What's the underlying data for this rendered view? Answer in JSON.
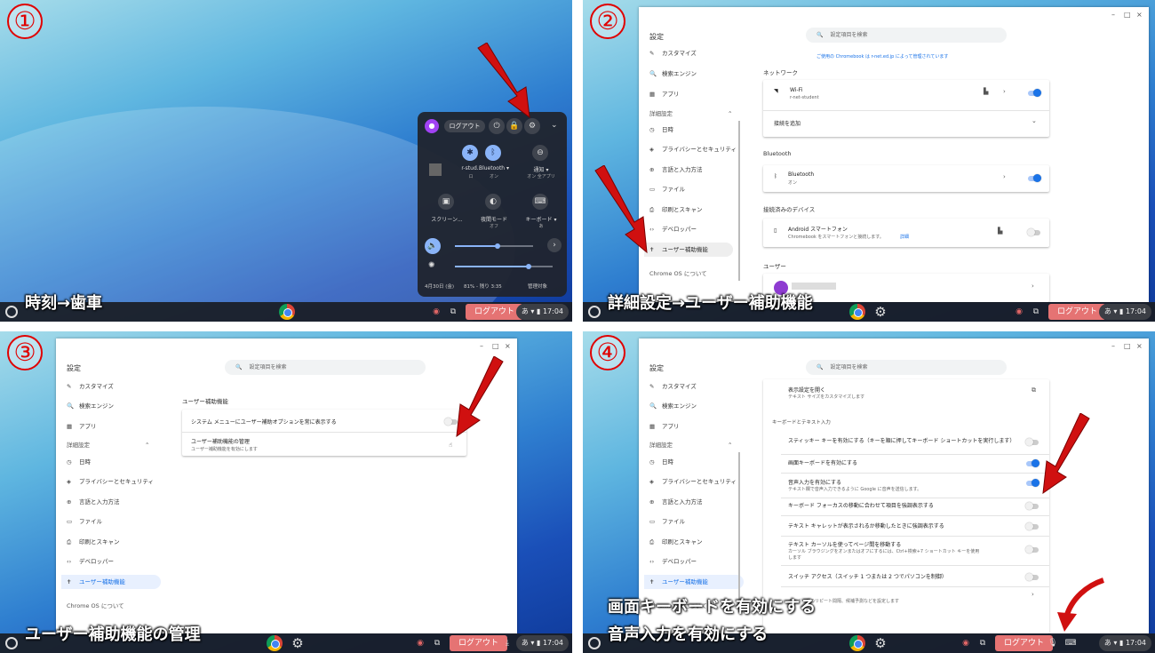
{
  "panels": {
    "p1": {
      "num": "①",
      "caption": "時刻→歯車"
    },
    "p2": {
      "num": "②",
      "caption": "詳細設定→ユーザー補助機能"
    },
    "p3": {
      "num": "③",
      "caption": "ユーザー補助機能の管理"
    },
    "p4": {
      "num": "④",
      "caption1": "画面キーボードを有効にする",
      "caption2": "音声入力を有効にする"
    }
  },
  "shelf": {
    "logout": "ログアウト",
    "time": "17:04",
    "ime": "あ"
  },
  "quick_settings": {
    "logout": "ログアウト",
    "wifi_label": "r-stud..",
    "wifi_sub": "ロ",
    "bt_label": "Bluetooth ▾",
    "bt_sub": "オン",
    "notif_label": "通知 ▾",
    "notif_sub": "オン 全アプリ",
    "screen_label": "スクリーン...",
    "night_label": "夜間モード",
    "night_sub": "オフ",
    "kb_label": "キーボード ▾",
    "kb_sub": "あ",
    "volume_level": 0.55,
    "brightness_level": 0.75,
    "date": "4月30日 (金)",
    "battery": "81% - 残り 3:35",
    "managed": "管理対象"
  },
  "settings": {
    "title": "設定",
    "search_placeholder": "設定項目を検索",
    "managed_notice": "ご使用の Chromebook は      r-net.ed.jp によって管理されています",
    "nav": {
      "customize": "カスタマイズ",
      "search_engine": "検索エンジン",
      "apps": "アプリ",
      "advanced": "詳細設定",
      "datetime": "日時",
      "privacy": "プライバシーとセキュリティ",
      "language": "言語と入力方法",
      "files": "ファイル",
      "print": "印刷とスキャン",
      "developer": "デベロッパー",
      "accessibility": "ユーザー補助機能",
      "about": "Chrome OS について"
    },
    "network": {
      "heading": "ネットワーク",
      "wifi": "Wi-Fi",
      "wifi_ssid": "r-net-student",
      "add": "接続を追加"
    },
    "bluetooth": {
      "heading": "Bluetooth",
      "label": "Bluetooth",
      "sub": "オン"
    },
    "devices": {
      "heading": "接続済みのデバイス",
      "android": "Android スマートフォン",
      "android_sub": "Chromebook をスマートフォンと接続します。",
      "detail": "詳細"
    },
    "user": {
      "heading": "ユーザー"
    },
    "a11y": {
      "heading": "ユーザー補助機能",
      "always_show": "システム メニューにユーザー補助オプションを常に表示する",
      "manage": "ユーザー補助機能の管理",
      "manage_sub": "ユーザー補助機能を有効にします"
    },
    "a11y_detail": {
      "display_open": "表示設定を開く",
      "display_sub": "テキスト サイズをカスタマイズします",
      "kb_heading": "キーボードとテキスト入力",
      "sticky": "スティッキー キーを有効にする（キーを順に押してキーボード ショートカットを実行します）",
      "onscreen": "画面キーボードを有効にする",
      "dictation": "音声入力を有効にする",
      "dictation_sub": "テキスト欄で音声入力できるように Google に音声を送信します。",
      "focus_highlight": "キーボード フォーカスの移動に合わせて項目を強調表示する",
      "caret_highlight": "テキスト キャレットが表示されるか移動したときに強調表示する",
      "caret_browse": "テキスト カーソルを使ってページ間を移動する",
      "caret_browse_sub1": "カーソル ブラウジングをオンまたはオフにするには、Ctrl+検索+7 ショートカット キーを使用",
      "caret_browse_sub2": "します",
      "switch_access": "スイッチ アクセス（スイッチ 1 つまたは 2 つでパソコンを制御）",
      "repeat_sub": "キーボードのリピート間隔、候補予測などを設定します"
    }
  },
  "colors": {
    "accent": "#1a73e8",
    "arrow": "#d01010",
    "logout": "#e57373"
  }
}
